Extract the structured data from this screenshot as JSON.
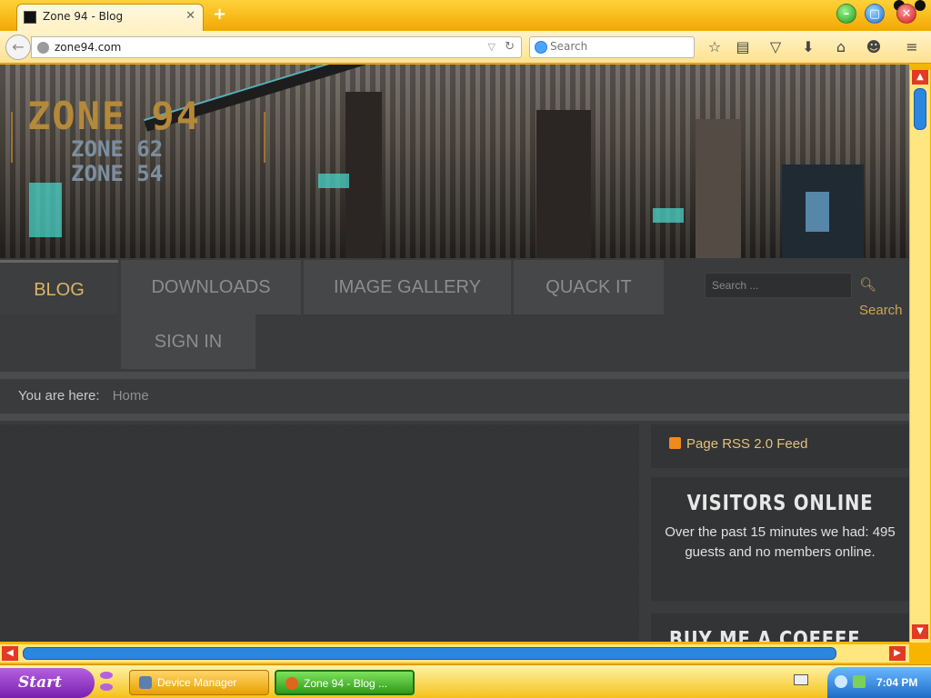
{
  "browser": {
    "tab_title": "Zone 94 - Blog",
    "url": "zone94.com",
    "search_placeholder": "Search"
  },
  "site": {
    "logo_main": "ZONE 94",
    "logo_sub1": "ZONE 62",
    "logo_sub2": "ZONE 54",
    "nav": [
      "BLOG",
      "DOWNLOADS",
      "IMAGE GALLERY",
      "QUACK IT",
      "SIGN IN"
    ],
    "nav_active": "BLOG",
    "search_placeholder": "Search ...",
    "search_button": "Search",
    "breadcrumb_label": "You are here:",
    "breadcrumb_home": "Home"
  },
  "sidebar": {
    "rss_label": "Page RSS 2.0 Feed",
    "visitors_title": "VISITORS ONLINE",
    "visitors_text": "Over the past 15 minutes we had: 495 guests and no members online.",
    "coffee_title": "BUY ME A COFFEE"
  },
  "taskbar": {
    "start_label": "Start",
    "tasks": [
      "Device Manager",
      "Zone 94 - Blog ..."
    ],
    "clock": "7:04 PM"
  },
  "colors": {
    "accent_gold": "#d8b46a",
    "chrome_yellow": "#f7b500",
    "scroll_blue": "#2b86e0"
  }
}
